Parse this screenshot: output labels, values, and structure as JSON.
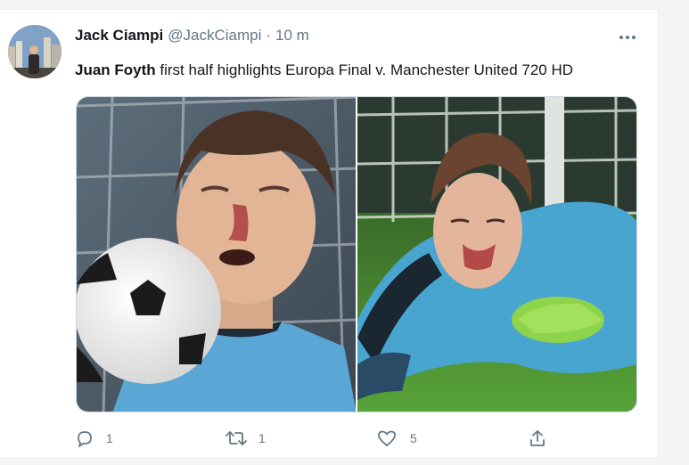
{
  "tweet": {
    "author_name": "Jack Ciampi",
    "handle": "@JackCiampi",
    "separator": "·",
    "time": "10 m",
    "text_bold": "Juan Foyth",
    "text_rest": " first half highlights Europa Final v. Manchester United 720 HD"
  },
  "actions": {
    "reply_count": "1",
    "retweet_count": "1",
    "like_count": "5"
  },
  "colors": {
    "text_primary": "#14171a",
    "text_secondary": "#657786",
    "background": "#ffffff"
  },
  "icons": [
    "more-icon",
    "reply-icon",
    "retweet-icon",
    "like-icon",
    "share-icon"
  ]
}
